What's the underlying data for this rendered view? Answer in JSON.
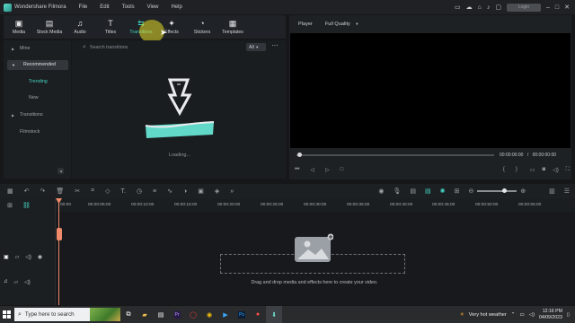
{
  "app": {
    "title": "Wondershare Filmora",
    "menu": [
      "File",
      "Edit",
      "Tools",
      "View",
      "Help"
    ],
    "login_label": "Login"
  },
  "library": {
    "tabs": [
      {
        "label": "Media",
        "icon": "media-icon"
      },
      {
        "label": "Stock Media",
        "icon": "stock-media-icon"
      },
      {
        "label": "Audio",
        "icon": "audio-icon"
      },
      {
        "label": "Titles",
        "icon": "titles-icon"
      },
      {
        "label": "Transitions",
        "icon": "transitions-icon",
        "active": true
      },
      {
        "label": "Effects",
        "icon": "effects-icon"
      },
      {
        "label": "Stickers",
        "icon": "stickers-icon"
      },
      {
        "label": "Templates",
        "icon": "templates-icon"
      }
    ],
    "nav": {
      "mine": "Mine",
      "recommended": "Recommended",
      "trending": "Trending",
      "new": "New",
      "transitions": "Transitions",
      "filmstock": "Filmstock"
    },
    "search_placeholder": "Search transitions",
    "filter_value": "All",
    "loading_text": "Loading..."
  },
  "player": {
    "label": "Player",
    "quality": "Full Quality",
    "timecode_current": "00:00:00:00",
    "timecode_total": "00:00:00:00",
    "progress": 0
  },
  "timeline": {
    "ruler_ticks": [
      "00:00",
      "00:00:05:00",
      "00:00:10:00",
      "00:00:15:00",
      "00:00:20:00",
      "00:00:25:00",
      "00:00:30:00",
      "00:00:35:00",
      "00:00:40:00",
      "00:00:45:00",
      "00:00:50:00",
      "00:00:55:00"
    ],
    "drop_text": "Drag and drop media and effects here to create your video."
  },
  "taskbar": {
    "search_placeholder": "Type here to search",
    "weather": "Very hot weather",
    "time": "12:16 PM",
    "date": "04/09/2023"
  },
  "colors": {
    "accent": "#46d5c4",
    "playhead": "#f08a6a",
    "background": "#151719"
  }
}
